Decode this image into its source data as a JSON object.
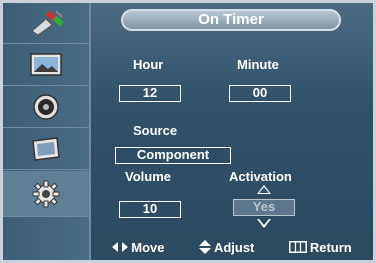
{
  "title": "On Timer",
  "sidebar": {
    "items": [
      {
        "icon": "antenna-plug-icon",
        "active": false
      },
      {
        "icon": "picture-screen-icon",
        "active": false
      },
      {
        "icon": "speaker-sound-icon",
        "active": false
      },
      {
        "icon": "channel-screen-icon",
        "active": false
      },
      {
        "icon": "gear-setup-icon",
        "active": true
      }
    ]
  },
  "fields": {
    "hour": {
      "label": "Hour",
      "value": "12"
    },
    "minute": {
      "label": "Minute",
      "value": "00"
    },
    "source": {
      "label": "Source",
      "value": "Component"
    },
    "volume": {
      "label": "Volume",
      "value": "10"
    },
    "activation": {
      "label": "Activation",
      "value": "Yes"
    }
  },
  "help": {
    "move": "Move",
    "adjust": "Adjust",
    "return": "Return"
  },
  "colors": {
    "background": "#2f5169",
    "border": "#c9d2dc",
    "text": "#ffffff"
  }
}
